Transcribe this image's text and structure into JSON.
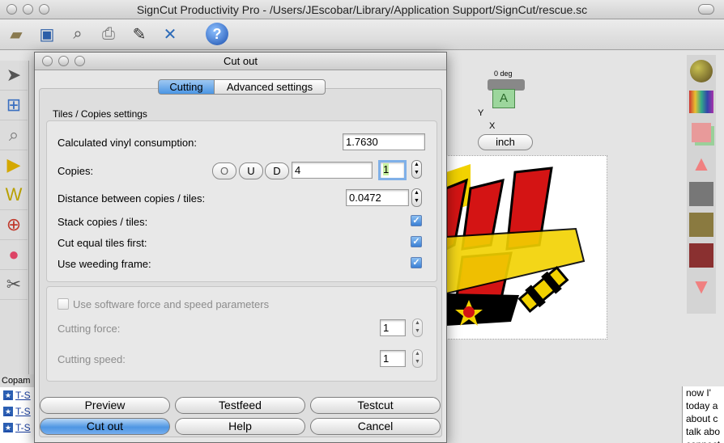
{
  "app": {
    "title": "SignCut Productivity Pro - /Users/JEscobar/Library/Application Support/SignCut/rescue.sc"
  },
  "toolbar": {
    "icons": [
      "folder-open-icon",
      "save-icon",
      "print-preview-icon",
      "printer-icon",
      "edit-pen-icon",
      "tools-icon",
      "help-icon"
    ],
    "help_glyph": "?"
  },
  "canvas": {
    "rotation_label": "0 deg",
    "unit_button": "inch",
    "axis_y": "Y",
    "axis_x": "X",
    "tile_letter": "A"
  },
  "lower_panel": {
    "title": "Copam",
    "items": [
      "T-S",
      "T-S",
      "T-S"
    ]
  },
  "right_text": {
    "lines": [
      "now I'",
      "today a",
      "about c",
      "talk abo",
      "connect"
    ]
  },
  "dialog": {
    "title": "Cut out",
    "tabs": [
      "Cutting",
      "Advanced settings"
    ],
    "group_title": "Tiles / Copies settings",
    "vinyl": {
      "label": "Calculated vinyl consumption:",
      "value": "1.7630"
    },
    "copies": {
      "label": "Copies:",
      "btn_o": "O",
      "btn_u": "U",
      "btn_d": "D",
      "value": "4",
      "value2": "1"
    },
    "distance": {
      "label": "Distance between copies / tiles:",
      "value": "0.0472"
    },
    "stack": {
      "label": "Stack copies / tiles:",
      "checked": true
    },
    "equal": {
      "label": "Cut equal tiles first:",
      "checked": true
    },
    "weeding": {
      "label": "Use weeding frame:",
      "checked": true
    },
    "software": {
      "label": "Use software force and speed parameters",
      "checked": false
    },
    "force": {
      "label": "Cutting force:",
      "value": "1"
    },
    "speed": {
      "label": "Cutting speed:",
      "value": "1"
    },
    "buttons": {
      "preview": "Preview",
      "testfeed": "Testfeed",
      "testcut": "Testcut",
      "cutout": "Cut out",
      "help": "Help",
      "cancel": "Cancel"
    }
  }
}
